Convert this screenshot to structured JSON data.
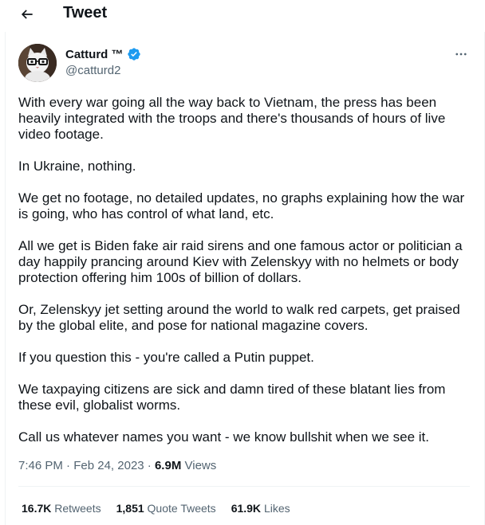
{
  "header": {
    "title": "Tweet"
  },
  "author": {
    "name": "Catturd ™",
    "handle": "@catturd2",
    "verified": true
  },
  "tweet": {
    "paragraphs": [
      "With every war going all the way back to Vietnam, the press has been heavily integrated with the troops and there's thousands of hours of live video footage.",
      "In Ukraine, nothing.",
      "We get no footage, no detailed updates, no graphs explaining how the war is going, who has control of what land, etc.",
      "All we get is Biden fake air raid sirens and one famous actor or politician a day happily prancing around Kiev with Zelenskyy with no helmets or body protection offering him 100s of billion of dollars.",
      "Or, Zelenskyy jet setting around the world to walk red carpets, get praised by the global elite, and pose for national magazine covers.",
      "If you question this - you're called a Putin puppet.",
      "We taxpaying citizens are sick and damn tired of these blatant lies from these evil, globalist worms.",
      "Call us whatever names you want - we know bullshit when we see it."
    ]
  },
  "meta": {
    "time": "7:46 PM",
    "separator": "·",
    "date": "Feb 24, 2023",
    "views_count": "6.9M",
    "views_label": "Views"
  },
  "stats": {
    "retweets_count": "16.7K",
    "retweets_label": "Retweets",
    "quotes_count": "1,851",
    "quotes_label": "Quote Tweets",
    "likes_count": "61.9K",
    "likes_label": "Likes"
  },
  "colors": {
    "text_primary": "#0f1419",
    "text_secondary": "#536471",
    "verified_blue": "#1d9bf0",
    "divider": "#eff3f4"
  }
}
